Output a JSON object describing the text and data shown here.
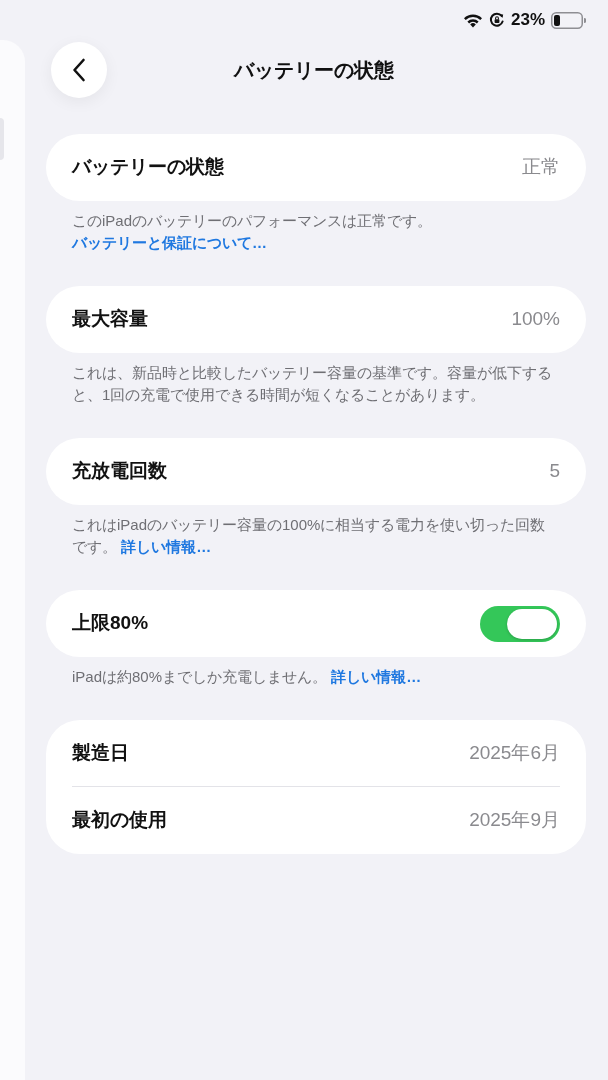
{
  "status_bar": {
    "battery": "23%"
  },
  "header": {
    "title": "バッテリーの状態"
  },
  "sections": [
    {
      "rows": [
        {
          "kind": "value",
          "label": "バッテリーの状態",
          "value": "正常"
        }
      ],
      "footer": {
        "text": "このiPadのバッテリーのパフォーマンスは正常です。",
        "link": "バッテリーと保証について…"
      }
    },
    {
      "rows": [
        {
          "kind": "value",
          "label": "最大容量",
          "value": "100%"
        }
      ],
      "footer": {
        "text": "これは、新品時と比較したバッテリー容量の基準です。容量が低下すると、1回の充電で使用できる時間が短くなることがあります。"
      }
    },
    {
      "rows": [
        {
          "kind": "value",
          "label": "充放電回数",
          "value": "5"
        }
      ],
      "footer": {
        "text": "これはiPadのバッテリー容量の100%に相当する電力を使い切った回数です。",
        "link": "詳しい情報…"
      }
    },
    {
      "rows": [
        {
          "kind": "toggle",
          "label": "上限80%",
          "on": true
        }
      ],
      "footer": {
        "text": "iPadは約80%までしか充電しません。",
        "link": "詳しい情報…"
      }
    },
    {
      "rows": [
        {
          "kind": "value",
          "label": "製造日",
          "value": "2025年6月"
        },
        {
          "kind": "value",
          "label": "最初の使用",
          "value": "2025年9月"
        }
      ]
    }
  ]
}
